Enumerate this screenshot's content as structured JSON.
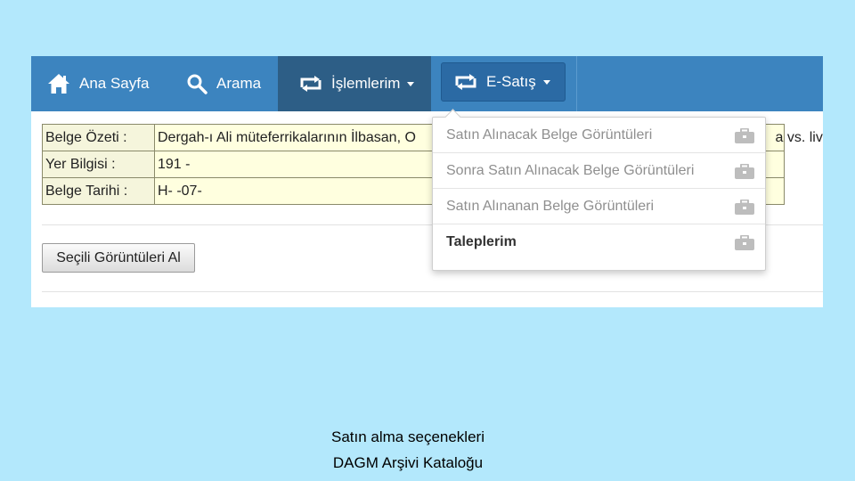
{
  "navbar": {
    "items": [
      {
        "label": "Ana Sayfa",
        "icon": "home-icon"
      },
      {
        "label": "Arama",
        "icon": "search-icon"
      },
      {
        "label": "İşlemlerim",
        "icon": "repeat-icon"
      },
      {
        "label": "E-Satış",
        "icon": "repeat-icon"
      }
    ]
  },
  "info": {
    "rows": [
      {
        "key": "Belge Özeti :",
        "value": "Dergah-ı Ali müteferrikalarının İlbasan, O",
        "tail": "a vs. liva"
      },
      {
        "key": "Yer Bilgisi :",
        "value": "191 -"
      },
      {
        "key": "Belge Tarihi :",
        "value": "H- -07-"
      }
    ]
  },
  "button": {
    "label": "Seçili Görüntüleri Al"
  },
  "dropdown": {
    "items": [
      {
        "label": "Satın Alınacak Belge Görüntüleri",
        "icon": "briefcase-icon"
      },
      {
        "label": "Sonra Satın Alınacak Belge Görüntüleri",
        "icon": "briefcase-icon"
      },
      {
        "label": "Satın Alınanan Belge Görüntüleri",
        "icon": "briefcase-icon"
      },
      {
        "label": "Taleplerim",
        "icon": "briefcase-icon"
      }
    ]
  },
  "caption": {
    "line1": "Satın alma seçenekleri",
    "line2": "DAGM Arşivi Kataloğu"
  },
  "colors": {
    "background": "#b3e8fc",
    "navbar": "#3c84bf",
    "navbar_active": "#2d5e86",
    "table_key_bg": "#f5f5dc",
    "table_value_bg": "#ffffdf"
  }
}
